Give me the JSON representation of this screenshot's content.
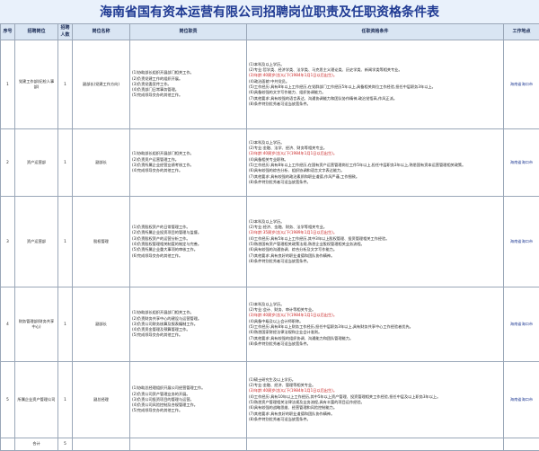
{
  "title": "海南省国有资本运营有限公司招聘岗位职责及任职资格条件表",
  "headers": {
    "no": "序号",
    "dept": "招聘岗位",
    "count": "招聘人数",
    "position": "岗位名称",
    "duty": "岗位职责",
    "req": "任职资格条件",
    "location": "工作地点"
  },
  "rows": [
    {
      "no": "1",
      "dept": "党建工作部(纪检人事部)",
      "count": "1",
      "position": "副部长(党建工作方向)",
      "duty": "(1)协助部长组织开展部门相关工作。\n(2)负责党建工作的组织开展。\n(3)负责党委宣传工作。\n(4)负责部门日常事务管理。\n(5)完成领导交办的其他工作。",
      "req": [
        {
          "t": "(1)本科及以上学历。",
          "red": false
        },
        {
          "t": "(2)专业:哲学类、经济学类、法学类、马克思主义理论类、历史学类、新闻学类等相关专业。",
          "red": false
        },
        {
          "t": "(3)年龄:40周岁(含)以下(1984年1月1日以后出生)。",
          "red": true
        },
        {
          "t": "(4)政治面貌:中共党员。",
          "red": false
        },
        {
          "t": "(5)工作经历:具有8年以上工作经历,在党群部门工作经历5年以上,具备相关岗位工作经验,担任中层职务3年以上。",
          "red": false
        },
        {
          "t": "(6)具备较强的文字写作能力、组织协调能力。",
          "red": false
        },
        {
          "t": "(7)其他要求:具有较强的语言表达、沟通协调能力和团队协作精神,政治觉悟高,作风正派。",
          "red": false
        },
        {
          "t": "(8)条件特别优秀者可适当放宽条件。",
          "red": false
        }
      ],
      "location": "海南省海口市"
    },
    {
      "no": "2",
      "dept": "资产运营部",
      "count": "1",
      "position": "副部长",
      "duty": "(1)协助部长组织开展部门相关工作。\n(2)负责资产运营管理工作。\n(3)负责所属企业经营业绩考核工作。\n(4)完成领导交办的其他工作。",
      "req": [
        {
          "t": "(1)本科及以上学历。",
          "red": false
        },
        {
          "t": "(2)专业:金融、法学、经济、财务等相关专业。",
          "red": false
        },
        {
          "t": "(3)年龄:40周岁(含)以下(1984年1月1日以后出生)。",
          "red": true
        },
        {
          "t": "(4)具备相关专业职称。",
          "red": false
        },
        {
          "t": "(5)工作经历:具有8年以上工作经历,在国有资产运营管理岗位工作5年以上,担任中层职务3年以上,熟悉国有资本运营管理相关政策。",
          "red": false
        },
        {
          "t": "(6)具有较强的综合分析、组织协调和语言文字表达能力。",
          "red": false
        },
        {
          "t": "(7)其他要求:具有较强的政治素质和职业道德,作风严谨,工作细致。",
          "red": false
        },
        {
          "t": "(8)条件特别优秀者可适当放宽条件。",
          "red": false
        }
      ],
      "location": "海南省海口市"
    },
    {
      "no": "3",
      "dept": "资产运营部",
      "count": "1",
      "position": "股权管理",
      "duty": "(1)负责股权资产的日常管理工作。\n(2)负责所属企业投资项目的管理与监督。\n(3)负责股权资产的运营分析工作。\n(4)负责股权管理相关制度的制定与完善。\n(5)负责所属企业重大事项的审核工作。\n(6)完成领导交办的其他工作。",
      "req": [
        {
          "t": "(1)本科及以上学历。",
          "red": false
        },
        {
          "t": "(2)专业:经济、金融、财务、法学等相关专业。",
          "red": false
        },
        {
          "t": "(3)年龄:35周岁(含)以下(1989年1月1日以后出生)。",
          "red": true
        },
        {
          "t": "(4)工作经历:具有5年以上工作经历,其中3年以上股权管理、投资管理相关工作经验。",
          "red": false
        },
        {
          "t": "(5)熟悉国有资产管理相关政策法规,熟悉企业股权管理相关业务流程。",
          "red": false
        },
        {
          "t": "(6)具有较强的沟通协调、综合分析及文字写作能力。",
          "red": false
        },
        {
          "t": "(7)其他要求:具有良好的职业道德和团队协作精神。",
          "red": false
        },
        {
          "t": "(8)条件特别优秀者可适当放宽条件。",
          "red": false
        }
      ],
      "location": "海南省海口市"
    },
    {
      "no": "4",
      "dept": "财务管理部(财务共享中心)",
      "count": "1",
      "position": "副部长",
      "duty": "(1)协助部长组织开展部门相关工作。\n(2)负责财务共享中心的建设与运营管理。\n(3)负责公司财务核算及报表编制工作。\n(4)负责资金管理及预算管理工作。\n(5)完成领导交办的其他工作。",
      "req": [
        {
          "t": "(1)本科及以上学历。",
          "red": false
        },
        {
          "t": "(2)专业:会计、财务、审计等相关专业。",
          "red": false
        },
        {
          "t": "(3)年龄:40周岁(含)以下(1984年1月1日以后出生)。",
          "red": true
        },
        {
          "t": "(4)具备中级及以上会计师职称。",
          "red": false
        },
        {
          "t": "(5)工作经历:具有8年以上财务工作经历,担任中层职务3年以上,具有财务共享中心工作经验者优先。",
          "red": false
        },
        {
          "t": "(6)熟悉国家财经法律法规和企业会计准则。",
          "red": false
        },
        {
          "t": "(7)其他要求:具有较强的组织协调、沟通能力和团队管理能力。",
          "red": false
        },
        {
          "t": "(8)条件特别优秀者可适当放宽条件。",
          "red": false
        }
      ],
      "location": "海南省海口市"
    },
    {
      "no": "5",
      "dept": "所属企业资产管理公司",
      "count": "1",
      "position": "副总经理",
      "duty": "(1)协助总经理组织开展公司经营管理工作。\n(2)负责公司资产管理业务的开展。\n(3)负责公司投资项目的管理与运营。\n(4)负责公司风险控制及合规管理工作。\n(5)完成领导交办的其他工作。",
      "req": [
        {
          "t": "(1)硕士研究生及以上学历。",
          "red": false
        },
        {
          "t": "(2)专业:金融、经济、管理等相关专业。",
          "red": false
        },
        {
          "t": "(3)年龄:40周岁(含)以下(1984年1月1日以后出生)。",
          "red": true
        },
        {
          "t": "(4)工作经历:具有10年以上工作经历,其中5年以上资产管理、投资管理相关工作经验,担任中层及以上职务3年以上。",
          "red": false
        },
        {
          "t": "(5)熟悉资产管理相关法律法规及业务流程,具有丰富的项目运作经验。",
          "red": false
        },
        {
          "t": "(6)具有较强的战略思维、经营管理和风险控制能力。",
          "red": false
        },
        {
          "t": "(7)其他要求:具有良好的职业道德和团队协作精神。",
          "red": false
        },
        {
          "t": "(8)条件特别优秀者可适当放宽条件。",
          "red": false
        }
      ],
      "location": "海南省海口市"
    }
  ],
  "footer": {
    "total_label": "合计",
    "total_count": "5"
  }
}
